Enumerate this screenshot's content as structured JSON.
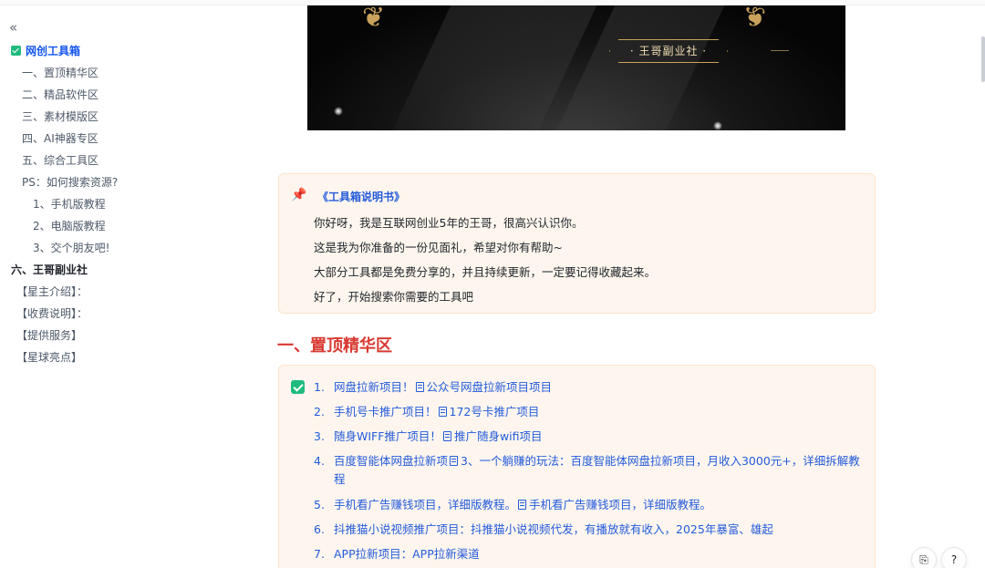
{
  "sidebar": {
    "collapse_glyph": "«",
    "items": [
      {
        "label": "网创工具箱",
        "level": "l0",
        "active": true,
        "checked": true
      },
      {
        "label": "一、置顶精华区",
        "level": "l1"
      },
      {
        "label": "二、精品软件区",
        "level": "l1"
      },
      {
        "label": "三、素材模版区",
        "level": "l1"
      },
      {
        "label": "四、AI神器专区",
        "level": "l1"
      },
      {
        "label": "五、综合工具区",
        "level": "l1"
      },
      {
        "label": "PS：如何搜索资源?",
        "level": "l1"
      },
      {
        "label": "1、手机版教程",
        "level": "l2"
      },
      {
        "label": "2、电脑版教程",
        "level": "l2"
      },
      {
        "label": "3、交个朋友吧!",
        "level": "l2"
      },
      {
        "label": "六、王哥副业社",
        "level": "l0"
      },
      {
        "label": "【星主介绍】：",
        "level": "b"
      },
      {
        "label": "【收费说明】：",
        "level": "b"
      },
      {
        "label": "【提供服务】",
        "level": "b"
      },
      {
        "label": "【星球亮点】",
        "level": "b"
      }
    ]
  },
  "banner": {
    "seal_text": "· 王哥副业社 ·"
  },
  "callout": {
    "icon": "pushpin-icon",
    "title": "《工具箱说明书》",
    "lines": [
      "你好呀，我是互联网创业5年的王哥，很高兴认识你。",
      "这是我为你准备的一份见面礼，希望对你有帮助~",
      "大部分工具都是免费分享的，并且持续更新，一定要记得收藏起来。",
      "好了，开始搜索你需要的工具吧"
    ]
  },
  "section": {
    "heading": "一、置顶精华区"
  },
  "list": {
    "items": [
      {
        "num": "1.",
        "before": "网盘拉新项目！",
        "doc": "公众号网盘拉新项目项目"
      },
      {
        "num": "2.",
        "before": "手机号卡推广项目！",
        "doc": "172号卡推广项目"
      },
      {
        "num": "3.",
        "before": "随身WIFF推广项目！",
        "doc": "推广随身wifi项目"
      },
      {
        "num": "4.",
        "before": "百度智能体网盘拉新项",
        "doc": "3、一个躺赚的玩法：百度智能体网盘拉新项目，月收入3000元+，详细拆解教程"
      },
      {
        "num": "5.",
        "before": "手机看广告赚钱项目，详细版教程。",
        "doc": "手机看广告赚钱项目，详细版教程。"
      },
      {
        "num": "6.",
        "before": "抖推猫小说视频推广项目：抖推猫小说视频代发，有播放就有收入，2025年暴富、雄起",
        "doc": ""
      },
      {
        "num": "7.",
        "before": "APP拉新项目：APP拉新渠道",
        "doc": ""
      }
    ]
  },
  "tools": {
    "help_glyph": "?",
    "share_glyph": "⎘"
  },
  "colors": {
    "accent": "#245bdb",
    "heading": "#d83931",
    "callout_bg": "#fef6ee",
    "check": "#1fbb7c"
  }
}
